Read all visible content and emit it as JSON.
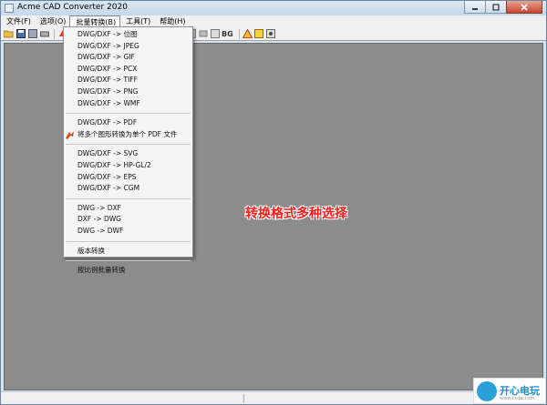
{
  "window": {
    "title": "Acme CAD Converter 2020"
  },
  "menubar": [
    "文件(F)",
    "选项(O)",
    "批量转换(B)",
    "工具(T)",
    "帮助(H)"
  ],
  "toolbar": {
    "bg_label": "BG"
  },
  "batch_menu": {
    "group_raster": [
      "DWG/DXF -> 位图",
      "DWG/DXF -> JPEG",
      "DWG/DXF -> GIF",
      "DWG/DXF -> PCX",
      "DWG/DXF -> TIFF",
      "DWG/DXF -> PNG",
      "DWG/DXF -> WMF"
    ],
    "group_pdf": [
      "DWG/DXF -> PDF",
      "将多个图形转换为单个 PDF 文件"
    ],
    "group_vector": [
      "DWG/DXF -> SVG",
      "DWG/DXF -> HP-GL/2",
      "DWG/DXF -> EPS",
      "DWG/DXF -> CGM"
    ],
    "group_dwg": [
      "DWG -> DXF",
      "DXF -> DWG",
      "DWG -> DWF"
    ],
    "version_convert": "版本转换",
    "scale_convert": "按比例批量转换"
  },
  "overlay_caption": "转换格式多种选择",
  "watermark": {
    "name": "开心电玩",
    "sub": "www.kxdw.com"
  },
  "colors": {
    "canvas": "#8c8c8c",
    "caption": "#ff1a1a",
    "close": "#c7462d"
  }
}
